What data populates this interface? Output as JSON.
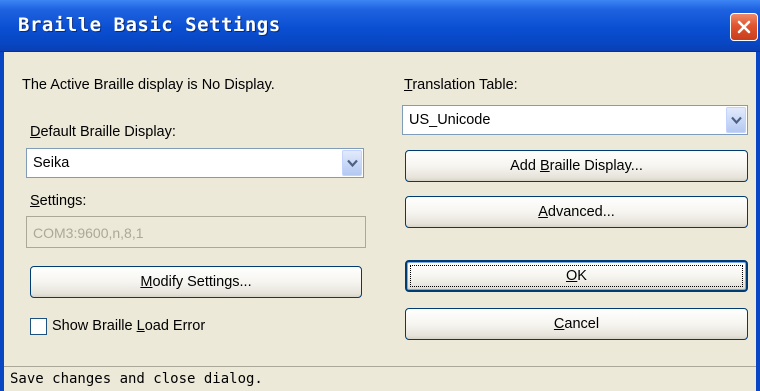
{
  "window": {
    "title": "Braille Basic Settings"
  },
  "active_display_text": "The Active Braille display is No Display.",
  "default_display": {
    "label_prefix": "",
    "label_hotkey": "D",
    "label_rest": "efault Braille Display:",
    "selected": "Seika"
  },
  "settings": {
    "label_hotkey": "S",
    "label_rest": "ettings:",
    "value": "COM3:9600,n,8,1"
  },
  "modify_button": {
    "hotkey": "M",
    "rest": "odify Settings..."
  },
  "show_load_error": {
    "prefix": "Show Braille ",
    "hotkey": "L",
    "rest": "oad Error",
    "checked": false
  },
  "translation_table": {
    "label_hotkey": "T",
    "label_rest": "ranslation Table:",
    "selected": "US_Unicode"
  },
  "add_display_button": {
    "prefix": "Add ",
    "hotkey": "B",
    "rest": "raille Display..."
  },
  "advanced_button": {
    "hotkey": "A",
    "rest": "dvanced..."
  },
  "ok_button": {
    "hotkey": "O",
    "rest": "K"
  },
  "cancel_button": {
    "hotkey": "C",
    "rest": "ancel"
  },
  "status_bar": {
    "text": "Save changes and close dialog."
  },
  "colors": {
    "titlebar": "#0a4fd2",
    "dialog_bg": "#ece9d8",
    "close_button": "#e0552f"
  },
  "icons": {
    "close": "close-icon",
    "dropdown": "chevron-down-icon"
  }
}
